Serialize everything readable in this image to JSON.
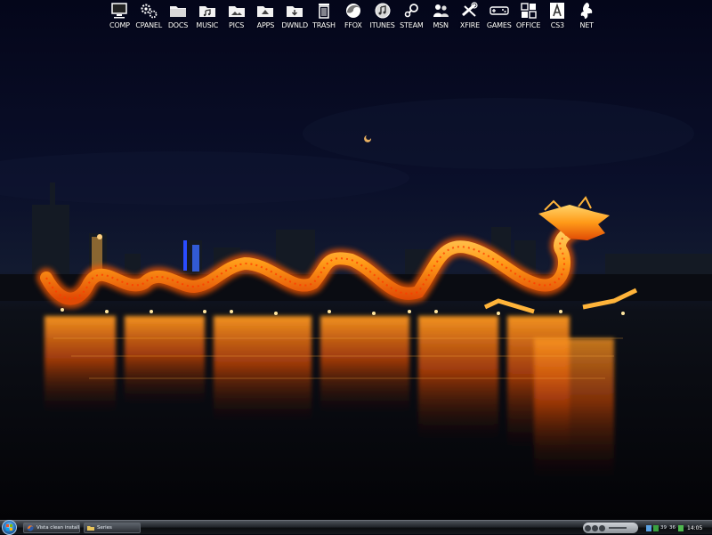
{
  "desktop": {
    "icons": [
      {
        "label": "COMP",
        "icon": "computer-icon"
      },
      {
        "label": "CPANEL",
        "icon": "gears-icon"
      },
      {
        "label": "DOCS",
        "icon": "folder-icon"
      },
      {
        "label": "MUSIC",
        "icon": "music-folder-icon"
      },
      {
        "label": "PICS",
        "icon": "pictures-folder-icon"
      },
      {
        "label": "APPS",
        "icon": "apps-folder-icon"
      },
      {
        "label": "DWNLD",
        "icon": "download-folder-icon"
      },
      {
        "label": "TRASH",
        "icon": "trash-icon"
      },
      {
        "label": "FFOX",
        "icon": "firefox-icon"
      },
      {
        "label": "ITUNES",
        "icon": "itunes-icon"
      },
      {
        "label": "STEAM",
        "icon": "steam-icon"
      },
      {
        "label": "MSN",
        "icon": "msn-icon"
      },
      {
        "label": "XFIRE",
        "icon": "xfire-icon"
      },
      {
        "label": "GAMES",
        "icon": "gamepad-icon"
      },
      {
        "label": "OFFICE",
        "icon": "office-icon"
      },
      {
        "label": "CS3",
        "icon": "adobe-cs3-icon"
      },
      {
        "label": "NET",
        "icon": "network-icon"
      }
    ],
    "wallpaper_icon": "dragon-lantern-night-photo"
  },
  "taskbar": {
    "start_icon": "windows-orb-icon",
    "buttons": [
      {
        "label": "Vista clean install Se...",
        "icon": "firefox-icon"
      },
      {
        "label": "Series",
        "icon": "folder-icon"
      }
    ],
    "media_icon": "media-player-controls-icon",
    "tray": {
      "text1": "39",
      "text2": "36",
      "clock": "14:05"
    }
  },
  "colors": {
    "sky_top": "#04061a",
    "sky_horizon": "#101828",
    "dragon": "#ffa020",
    "dragon_glow": "#ff5a00",
    "taskbar": "#15181c"
  }
}
